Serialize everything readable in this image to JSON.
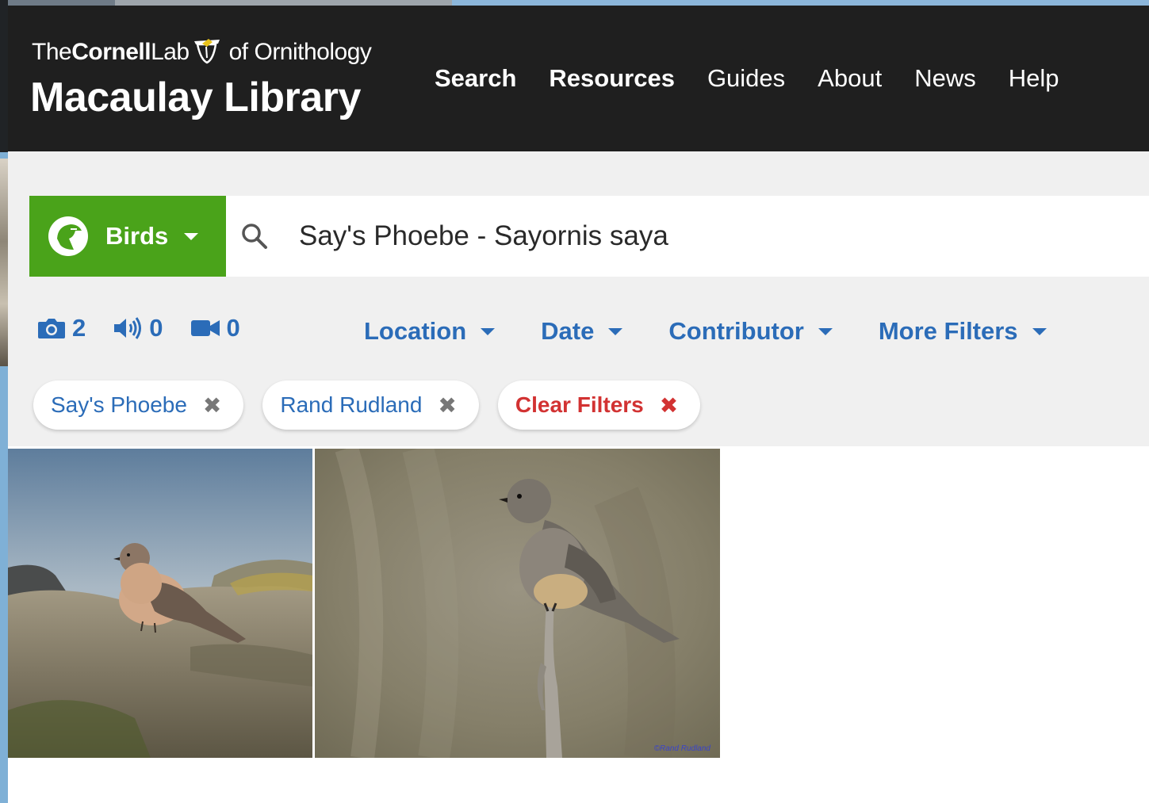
{
  "header": {
    "logo_the": "The",
    "logo_cornell": "Cornell",
    "logo_lab": "Lab",
    "logo_of": "of Ornithology",
    "logo_main": "Macaulay Library",
    "nav": [
      {
        "label": "Search",
        "bold": true
      },
      {
        "label": "Resources",
        "bold": true
      },
      {
        "label": "Guides",
        "bold": false
      },
      {
        "label": "About",
        "bold": false
      },
      {
        "label": "News",
        "bold": false
      },
      {
        "label": "Help",
        "bold": false
      }
    ]
  },
  "search": {
    "taxon_label": "Birds",
    "query": "Say's Phoebe - Sayornis saya"
  },
  "media_counts": {
    "photos": "2",
    "audio": "0",
    "video": "0"
  },
  "filters": {
    "location": "Location",
    "date": "Date",
    "contributor": "Contributor",
    "more": "More Filters"
  },
  "chips": {
    "species": "Say's Phoebe",
    "contributor": "Rand Rudland",
    "clear": "Clear Filters",
    "remove_glyph": "✖"
  },
  "results": {
    "watermark": "©Rand Rudland"
  },
  "colors": {
    "header_bg": "#1f1f1f",
    "taxon_green": "#4aa31a",
    "link_blue": "#2b6cb8",
    "clear_red": "#d23232",
    "band_gray": "#f0f0f0"
  },
  "icons": [
    "bird-logo-icon",
    "birds-taxon-icon",
    "chevron-down-icon",
    "search-icon",
    "camera-icon",
    "speaker-icon",
    "video-icon",
    "close-icon"
  ]
}
